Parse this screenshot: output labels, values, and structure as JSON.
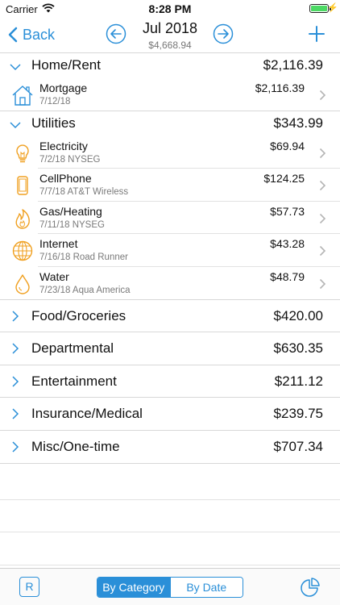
{
  "status_bar": {
    "carrier": "Carrier",
    "time": "8:28 PM"
  },
  "nav": {
    "back_label": "Back",
    "title": "Jul 2018",
    "subtitle": "$4,668.94"
  },
  "categories": [
    {
      "name": "Home/Rent",
      "amount": "$2,116.39",
      "expanded": true,
      "items": [
        {
          "name": "Mortgage",
          "detail": "7/12/18",
          "amount": "$2,116.39",
          "icon": "house-icon"
        }
      ]
    },
    {
      "name": "Utilities",
      "amount": "$343.99",
      "expanded": true,
      "items": [
        {
          "name": "Electricity",
          "detail": "7/2/18 NYSEG",
          "amount": "$69.94",
          "icon": "lightbulb-icon"
        },
        {
          "name": "CellPhone",
          "detail": "7/7/18 AT&T Wireless",
          "amount": "$124.25",
          "icon": "phone-icon"
        },
        {
          "name": "Gas/Heating",
          "detail": "7/11/18 NYSEG",
          "amount": "$57.73",
          "icon": "flame-icon"
        },
        {
          "name": "Internet",
          "detail": "7/16/18 Road Runner",
          "amount": "$43.28",
          "icon": "globe-icon"
        },
        {
          "name": "Water",
          "detail": "7/23/18 Aqua America",
          "amount": "$48.79",
          "icon": "water-drop-icon"
        }
      ]
    },
    {
      "name": "Food/Groceries",
      "amount": "$420.00",
      "expanded": false
    },
    {
      "name": "Departmental",
      "amount": "$630.35",
      "expanded": false
    },
    {
      "name": "Entertainment",
      "amount": "$211.12",
      "expanded": false
    },
    {
      "name": "Insurance/Medical",
      "amount": "$239.75",
      "expanded": false
    },
    {
      "name": "Misc/One-time",
      "amount": "$707.34",
      "expanded": false
    }
  ],
  "toolbar": {
    "r_label": "R",
    "segments": [
      {
        "label": "By Category",
        "active": true
      },
      {
        "label": "By Date",
        "active": false
      }
    ]
  },
  "colors": {
    "accent": "#2a8fd8",
    "icon_orange": "#f0a020",
    "icon_blue": "#2a8fd8"
  }
}
